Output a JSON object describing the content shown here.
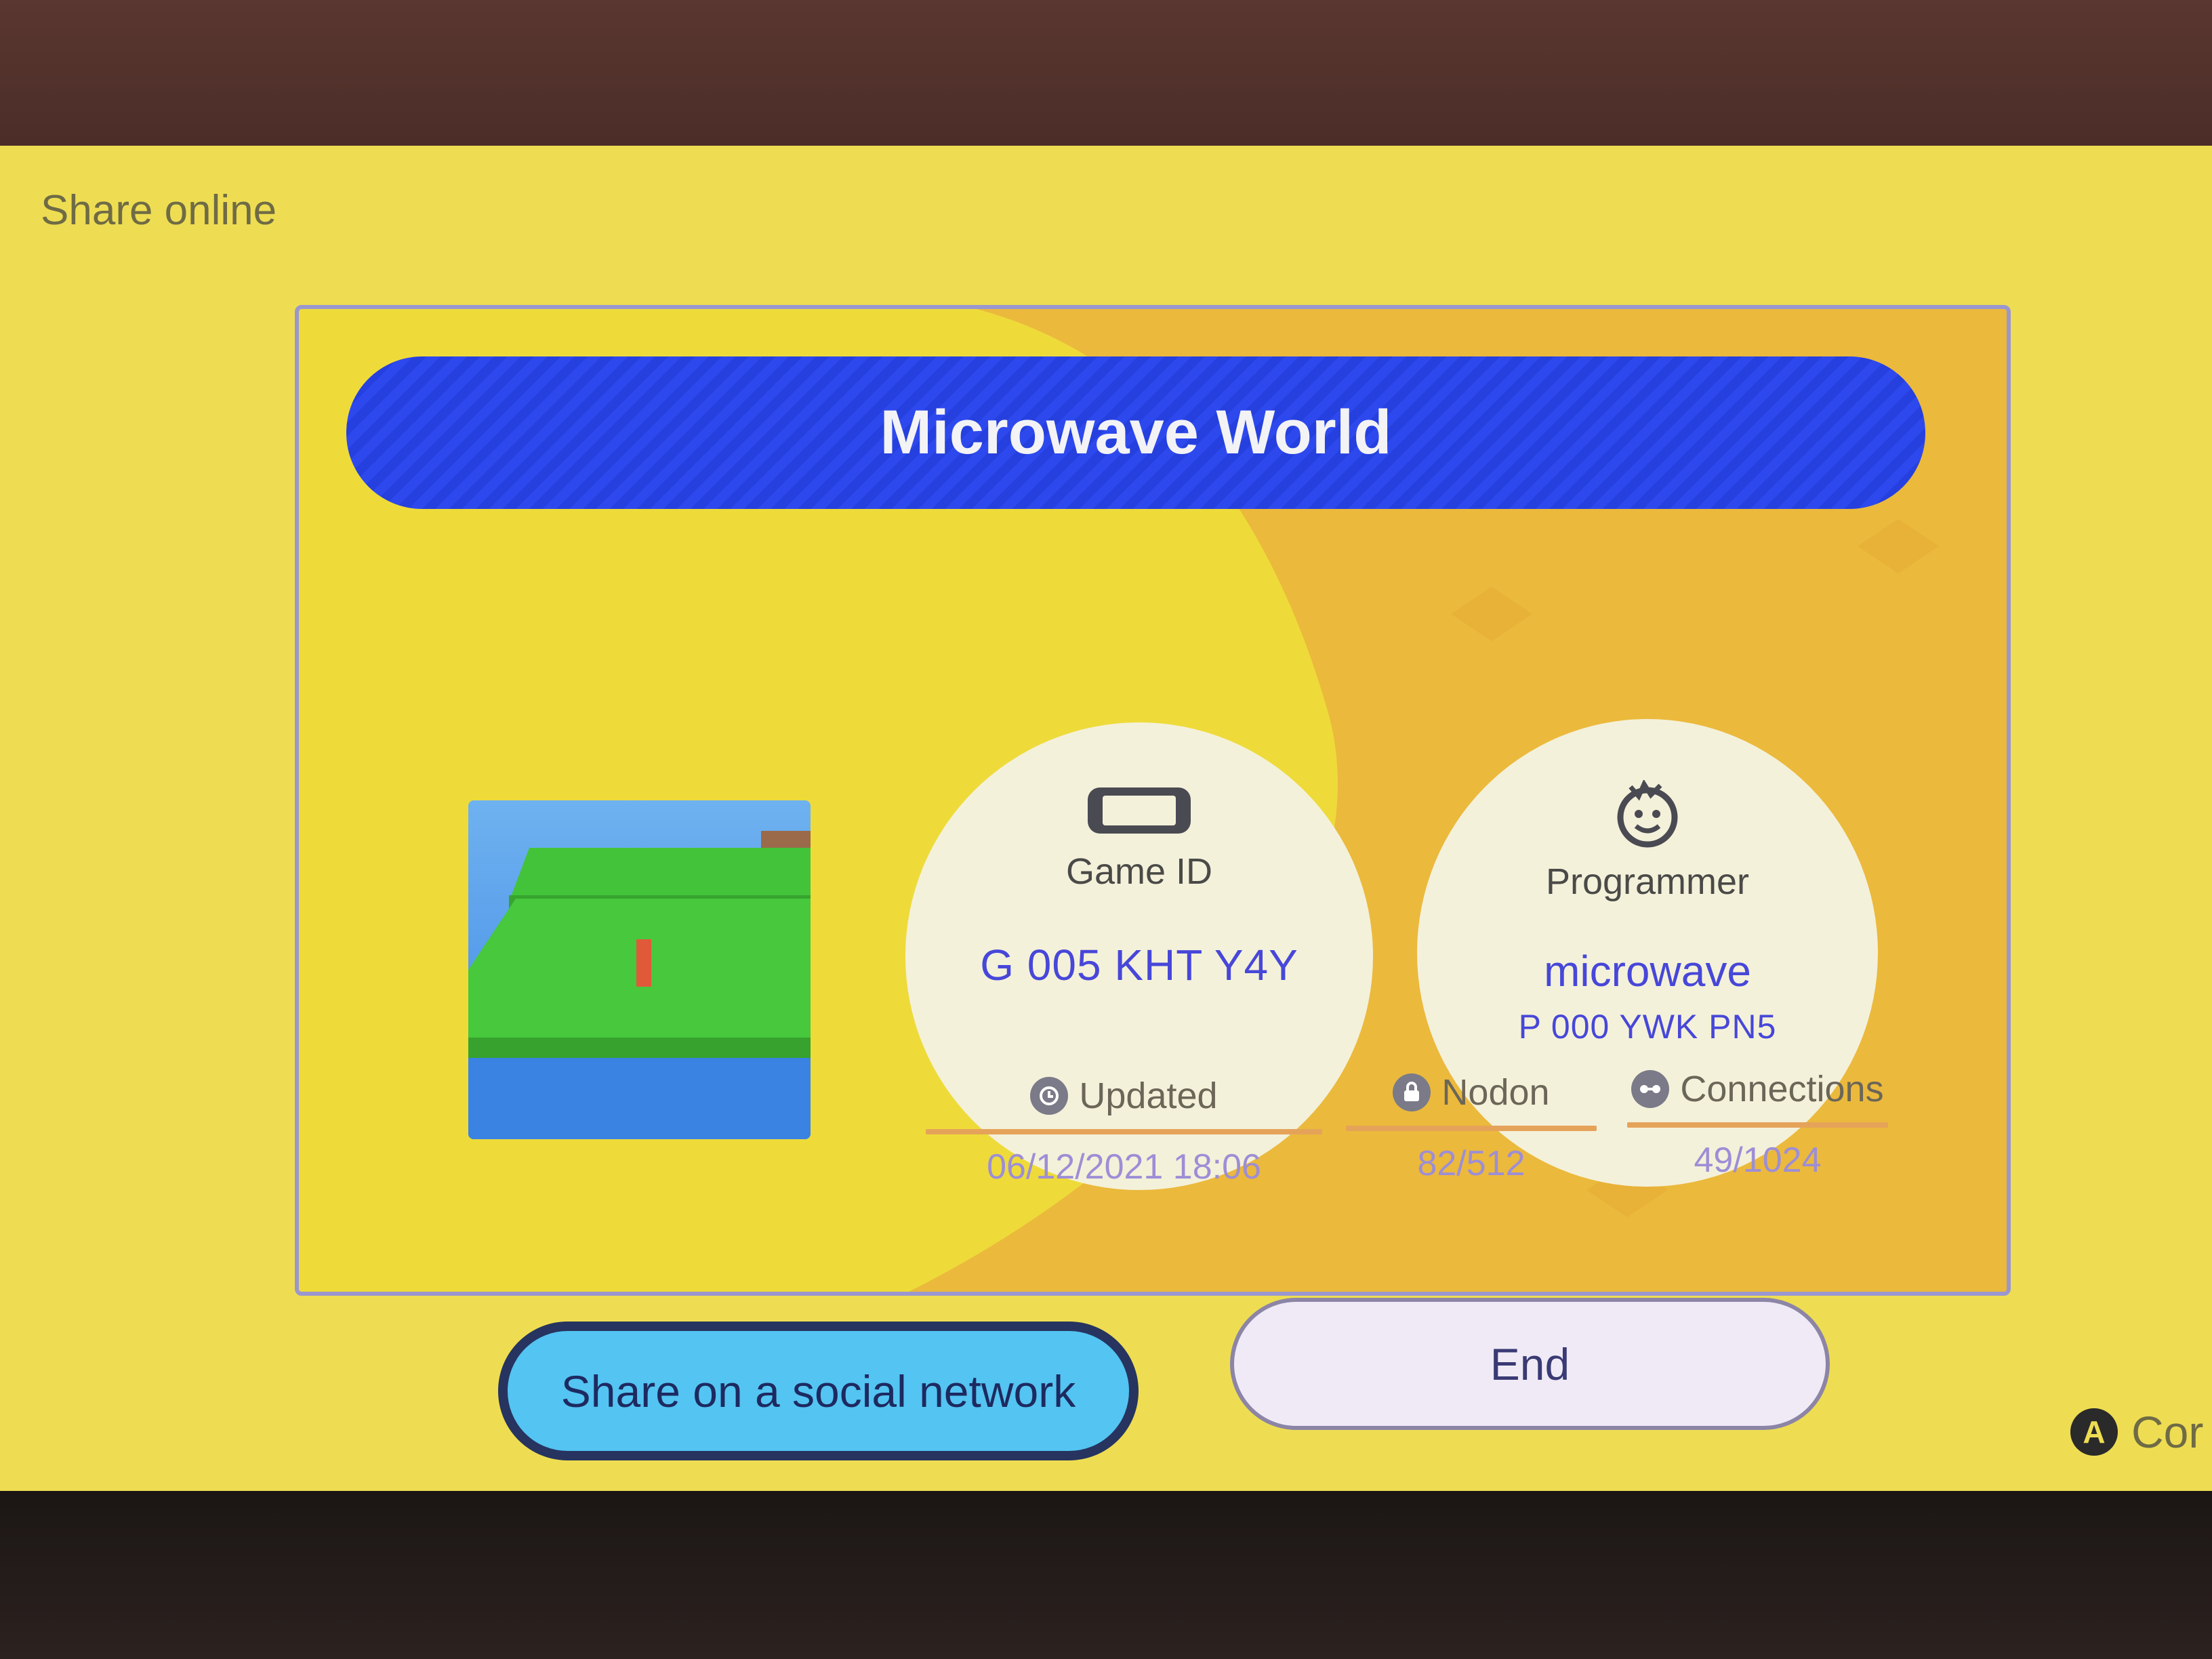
{
  "header": {
    "title": "Share online"
  },
  "game": {
    "title": "Microwave World",
    "game_id_label": "Game ID",
    "game_id": "G 005 KHT Y4Y",
    "programmer_label": "Programmer",
    "programmer_name": "microwave",
    "programmer_id": "P 000 YWK PN5"
  },
  "stats": {
    "updated_label": "Updated",
    "updated_value": "06/12/2021 18:06",
    "nodon_label": "Nodon",
    "nodon_value": "82/512",
    "connections_label": "Connections",
    "connections_value": "49/1024"
  },
  "buttons": {
    "share_label": "Share on a social network",
    "end_label": "End"
  },
  "hint": {
    "button": "A",
    "label": "Cor"
  },
  "colors": {
    "screen_bg": "#eedd52",
    "title_bar": "#2d49ee",
    "share_button": "#54c4f2",
    "value_text": "#4747d9"
  },
  "icons": [
    "console-icon",
    "programmer-face-icon",
    "clock-icon",
    "lock-icon",
    "connection-icon",
    "a-button-icon"
  ]
}
